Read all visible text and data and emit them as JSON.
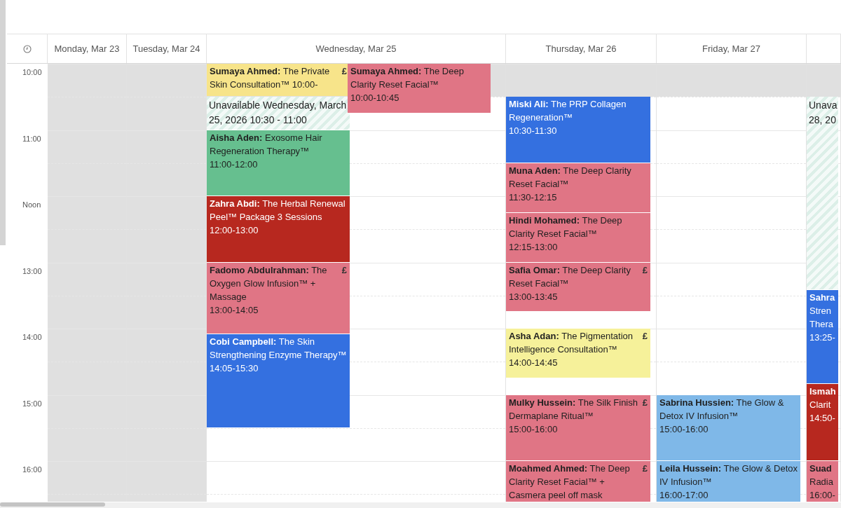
{
  "time_labels": [
    "10:00",
    "11:00",
    "Noon",
    "13:00",
    "14:00",
    "15:00",
    "16:00"
  ],
  "days": [
    {
      "label": "Monday, Mar 23",
      "closed": true
    },
    {
      "label": "Tuesday, Mar 24",
      "closed": true
    },
    {
      "label": "Wednesday, Mar 25",
      "closed": false,
      "events": [
        {
          "kind": "appointment",
          "color": "#f7e48a",
          "text": "**Sumaya Ahmed:** The Private Skin Consultation™ 10:00-",
          "badge": "£"
        },
        {
          "kind": "appointment",
          "color": "#e07585",
          "text": "**Sumaya Ahmed:** The Deep Clarity Reset Facial™",
          "time": "10:00-10:45"
        },
        {
          "kind": "unavailable",
          "text": "Unavailable Wednesday, March 25, 2026 10:30 - 11:00"
        },
        {
          "kind": "appointment",
          "color": "#66bf8f",
          "text": "**Aisha Aden:** Exosome Hair Regeneration Therapy™",
          "time": "11:00-12:00"
        },
        {
          "kind": "appointment",
          "color": "#b7281f",
          "text": "**Zahra Abdi:** The Herbal Renewal Peel™ Package 3 Sessions",
          "time": "12:00-13:00"
        },
        {
          "kind": "appointment",
          "color": "#e07585",
          "text": "**Fadomo Abdulrahman:** The Oxygen Glow Infusion™ + Massage",
          "time": "13:00-14:05",
          "badge": "£"
        },
        {
          "kind": "appointment",
          "color": "#3470e0",
          "text": "**Cobi Campbell:** The Skin Strengthening Enzyme Therapy™",
          "time": "14:05-15:30"
        }
      ]
    },
    {
      "label": "Thursday, Mar 26",
      "closed": false,
      "events": [
        {
          "kind": "appointment",
          "color": "#3470e0",
          "text": "**Miski Ali:** The PRP Collagen Regeneration™",
          "time": "10:30-11:30"
        },
        {
          "kind": "appointment",
          "color": "#e07585",
          "text": "**Muna Aden:** The Deep Clarity Reset Facial™",
          "time": "11:30-12:15"
        },
        {
          "kind": "appointment",
          "color": "#e07585",
          "text": "**Hindi Mohamed:** The Deep Clarity Reset Facial™",
          "time": "12:15-13:00"
        },
        {
          "kind": "appointment",
          "color": "#e07585",
          "text": "**Safia Omar:** The Deep Clarity Reset Facial™",
          "time": "13:00-13:45",
          "badge": "£"
        },
        {
          "kind": "appointment",
          "color": "#f6f19a",
          "text": "**Asha Adan:** The Pigmentation Intelligence Consultation™",
          "time": "14:00-14:45",
          "badge": "£"
        },
        {
          "kind": "appointment",
          "color": "#e07585",
          "text": "**Mulky Hussein:** The Silk Finish Dermaplane Ritual™",
          "time": "15:00-16:00",
          "badge": "£"
        },
        {
          "kind": "appointment",
          "color": "#e07585",
          "text": "**Moahmed Ahmed:** The Deep Clarity Reset Facial™ + Casmera peel off mask",
          "badge": "£"
        }
      ]
    },
    {
      "label": "Friday, Mar 27",
      "closed": false,
      "events": [
        {
          "kind": "appointment",
          "color": "#7fb8e8",
          "text": "**Sabrina Hussien:** The Glow & Detox IV Infusion™",
          "time": "15:00-16:00"
        },
        {
          "kind": "appointment",
          "color": "#7fb8e8",
          "text": "**Leila Hussein:** The Glow & Detox IV Infusion™",
          "time": "16:00-17:00"
        }
      ]
    },
    {
      "closed": false,
      "events": [
        {
          "kind": "unavailable",
          "lines": [
            "Unava",
            "28, 20"
          ]
        },
        {
          "kind": "appointment",
          "color": "#3470e0",
          "lines": [
            "Sahra",
            "Stren",
            "Thera",
            "13:25-"
          ]
        },
        {
          "kind": "appointment",
          "color": "#b7281f",
          "lines": [
            "Ismah",
            "Clarit",
            "14:50-"
          ]
        },
        {
          "kind": "appointment",
          "color": "#e07585",
          "lines": [
            "Suad",
            "Radia",
            "16:00-"
          ]
        }
      ]
    }
  ]
}
